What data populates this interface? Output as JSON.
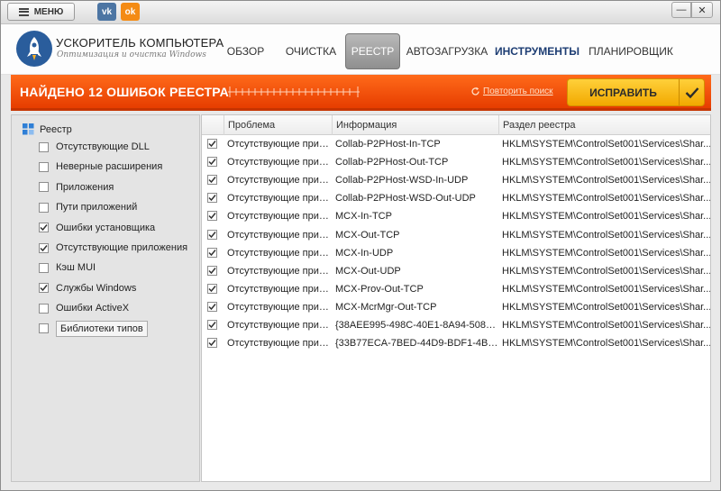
{
  "titlebar": {
    "menu_label": "МЕНЮ",
    "vk_label": "vk",
    "ok_label": "ok",
    "minimize_glyph": "—",
    "close_glyph": "✕"
  },
  "brand": {
    "title": "УСКОРИТЕЛЬ КОМПЬЮТЕРА",
    "subtitle": "Оптимизация и очистка Windows"
  },
  "nav": [
    {
      "label": "ОБЗОР",
      "active": false
    },
    {
      "label": "ОЧИСТКА",
      "active": false
    },
    {
      "label": "РЕЕСТР",
      "active": true
    },
    {
      "label": "АВТОЗАГРУЗКА",
      "active": false
    },
    {
      "label": "ИНСТРУМЕНТЫ",
      "active": false
    },
    {
      "label": "ПЛАНИРОВЩИК",
      "active": false
    }
  ],
  "status": {
    "found_text": "НАЙДЕНО 12 ОШИБОК РЕЕСТРА",
    "repeat_label": "Повторить поиск",
    "fix_label": "ИСПРАВИТЬ"
  },
  "tree": {
    "root_label": "Реестр",
    "items": [
      {
        "label": "Отсутствующие DLL",
        "checked": false
      },
      {
        "label": "Неверные расширения",
        "checked": false
      },
      {
        "label": "Приложения",
        "checked": false
      },
      {
        "label": "Пути приложений",
        "checked": false
      },
      {
        "label": "Ошибки установщика",
        "checked": true
      },
      {
        "label": "Отсутствующие приложения",
        "checked": true
      },
      {
        "label": "Кэш MUI",
        "checked": false
      },
      {
        "label": "Службы Windows",
        "checked": true
      },
      {
        "label": "Ошибки ActiveX",
        "checked": false
      },
      {
        "label": "Библиотеки типов",
        "checked": false
      }
    ]
  },
  "table": {
    "columns": [
      "Проблема",
      "Информация",
      "Раздел реестра"
    ],
    "rows": [
      {
        "checked": true,
        "problem": "Отсутствующие прил...",
        "info": "Collab-P2PHost-In-TCP",
        "key": "HKLM\\SYSTEM\\ControlSet001\\Services\\Shar..."
      },
      {
        "checked": true,
        "problem": "Отсутствующие прил...",
        "info": "Collab-P2PHost-Out-TCP",
        "key": "HKLM\\SYSTEM\\ControlSet001\\Services\\Shar..."
      },
      {
        "checked": true,
        "problem": "Отсутствующие прил...",
        "info": "Collab-P2PHost-WSD-In-UDP",
        "key": "HKLM\\SYSTEM\\ControlSet001\\Services\\Shar..."
      },
      {
        "checked": true,
        "problem": "Отсутствующие прил...",
        "info": "Collab-P2PHost-WSD-Out-UDP",
        "key": "HKLM\\SYSTEM\\ControlSet001\\Services\\Shar..."
      },
      {
        "checked": true,
        "problem": "Отсутствующие прил...",
        "info": "MCX-In-TCP",
        "key": "HKLM\\SYSTEM\\ControlSet001\\Services\\Shar..."
      },
      {
        "checked": true,
        "problem": "Отсутствующие прил...",
        "info": "MCX-Out-TCP",
        "key": "HKLM\\SYSTEM\\ControlSet001\\Services\\Shar..."
      },
      {
        "checked": true,
        "problem": "Отсутствующие прил...",
        "info": "MCX-In-UDP",
        "key": "HKLM\\SYSTEM\\ControlSet001\\Services\\Shar..."
      },
      {
        "checked": true,
        "problem": "Отсутствующие прил...",
        "info": "MCX-Out-UDP",
        "key": "HKLM\\SYSTEM\\ControlSet001\\Services\\Shar..."
      },
      {
        "checked": true,
        "problem": "Отсутствующие прил...",
        "info": "MCX-Prov-Out-TCP",
        "key": "HKLM\\SYSTEM\\ControlSet001\\Services\\Shar..."
      },
      {
        "checked": true,
        "problem": "Отсутствующие прил...",
        "info": "MCX-McrMgr-Out-TCP",
        "key": "HKLM\\SYSTEM\\ControlSet001\\Services\\Shar..."
      },
      {
        "checked": true,
        "problem": "Отсутствующие прил...",
        "info": "{38AEE995-498C-40E1-8A94-50879...",
        "key": "HKLM\\SYSTEM\\ControlSet001\\Services\\Shar..."
      },
      {
        "checked": true,
        "problem": "Отсутствующие прил...",
        "info": "{33B77ECA-7BED-44D9-BDF1-4BDD2...",
        "key": "HKLM\\SYSTEM\\ControlSet001\\Services\\Shar..."
      }
    ]
  },
  "colors": {
    "accent_orange": "#ff5a0a",
    "fix_yellow": "#ffc51a",
    "nav_highlight": "#1d3d73"
  }
}
